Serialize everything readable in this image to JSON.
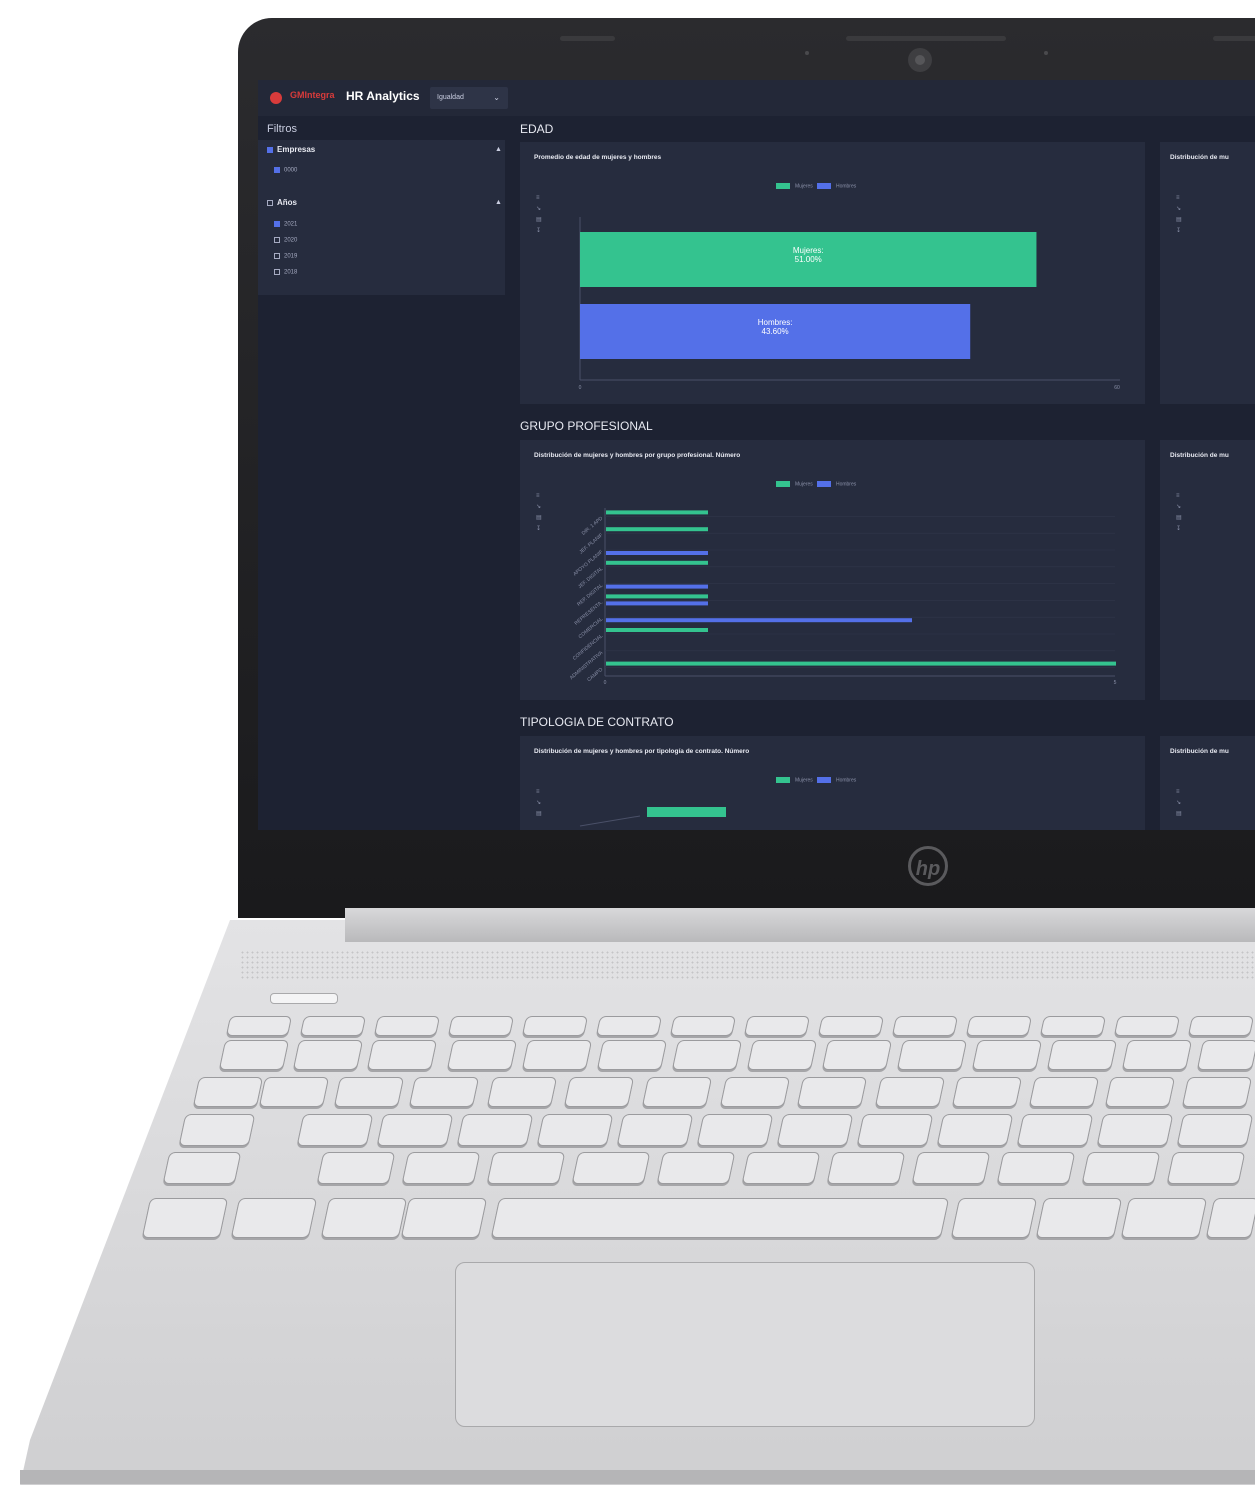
{
  "header": {
    "brand": "GMIntegra",
    "app_title": "HR Analytics",
    "select_value": "Igualdad"
  },
  "sidebar": {
    "title": "Filtros",
    "groups": [
      {
        "label": "Empresas",
        "checked": true,
        "options": [
          {
            "label": "0000",
            "checked": true
          }
        ]
      },
      {
        "label": "Años",
        "checked": false,
        "options": [
          {
            "label": "2021",
            "checked": true
          },
          {
            "label": "2020",
            "checked": false
          },
          {
            "label": "2019",
            "checked": false
          },
          {
            "label": "2018",
            "checked": false
          }
        ]
      }
    ]
  },
  "sections": {
    "edad": "EDAD",
    "grupo": "GRUPO PROFESIONAL",
    "tipologia": "TIPOLOGIA DE CONTRATO"
  },
  "cards": {
    "edad_title": "Promedio de edad de mujeres y hombres",
    "edad_right_title": "Distribución de mu",
    "grupo_title": "Distribución de mujeres y hombres por grupo profesional. Número",
    "grupo_right_title": "Distribución de mu",
    "tipologia_title": "Distribución de mujeres y hombres por tipología de contrato. Número",
    "tipologia_right_title": "Distribución de mu"
  },
  "legend": {
    "mujeres": "Mujeres",
    "hombres": "Hombres"
  },
  "colors": {
    "mujeres": "#34c38f",
    "hombres": "#5470e8",
    "background": "#1d2232",
    "card": "#262c3e"
  },
  "chart_data": [
    {
      "type": "bar",
      "orientation": "horizontal",
      "title": "Promedio de edad de mujeres y hombres",
      "categories": [
        "Mujeres",
        "Hombres"
      ],
      "values": [
        51.0,
        43.6
      ],
      "data_labels": [
        "Mujeres:\n51.00%",
        "Hombres:\n43.60%"
      ],
      "xlim": [
        0,
        60
      ],
      "x_ticks": [
        "0",
        "60"
      ]
    },
    {
      "type": "bar",
      "orientation": "horizontal",
      "title": "Distribución de mujeres y hombres por grupo profesional. Número",
      "categories": [
        "DIR. 1 APD",
        "JEF. PLANIF",
        "APOYO PLANIF",
        "JEF. DIGITAL",
        "REP. DIGITAL",
        "REPRESENTA.",
        "COMERCIAL",
        "CONFIDENCIAL",
        "ADMINISTRATIVA",
        "CAMPO"
      ],
      "series": [
        {
          "name": "Mujeres",
          "values": [
            1,
            1,
            0,
            1,
            0,
            1,
            0,
            1,
            0,
            5
          ]
        },
        {
          "name": "Hombres",
          "values": [
            0,
            0,
            1,
            0,
            1,
            1,
            3,
            0,
            0,
            0
          ]
        }
      ],
      "xlim": [
        0,
        5
      ],
      "x_ticks": [
        "0",
        "5"
      ]
    },
    {
      "type": "bar",
      "title": "Distribución de mujeres y hombres por tipología de contrato. Número",
      "series": [
        {
          "name": "Mujeres",
          "values": [
            1
          ]
        }
      ]
    }
  ]
}
